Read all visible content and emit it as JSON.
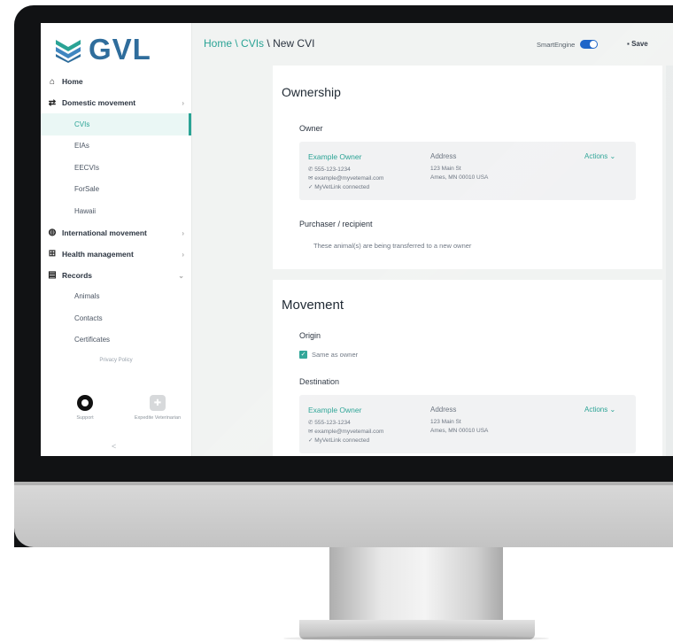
{
  "brand": {
    "name": "GVL",
    "accent": "#2aa395",
    "logo_color": "#2f6d9c",
    "toggle_color": "#1f66c8"
  },
  "header": {
    "breadcrumb": {
      "home": "Home",
      "sep1": "\\",
      "cvis": "CVIs",
      "sep2": "\\",
      "current": "New CVI"
    },
    "smart_engine_label": "SmartEngine",
    "smart_engine_on": true,
    "save_label": "Save"
  },
  "sidebar": {
    "home": "Home",
    "domestic": "Domestic movement",
    "domestic_items": [
      "CVIs",
      "EIAs",
      "EECVIs",
      "ForSale",
      "Hawaii"
    ],
    "international": "International movement",
    "health": "Health management",
    "records": "Records",
    "records_items": [
      "Animals",
      "Contacts",
      "Certificates"
    ],
    "privacy": "Privacy Policy",
    "support": "Support",
    "expedite": "Expedite Veterinarian",
    "collapse": "<"
  },
  "ownership": {
    "title": "Ownership",
    "owner_label": "Owner",
    "owner_card": {
      "name": "Example Owner",
      "phone": "555-123-1234",
      "email": "example@myvetemail.com",
      "link": "MyVetLink connected",
      "address_label": "Address",
      "address_line1": "123 Main St",
      "address_line2": "Ames, MN 00010 USA",
      "actions": "Actions"
    },
    "purchaser_label": "Purchaser / recipient",
    "purchaser_text": "These animal(s) are being transferred to a new owner"
  },
  "movement": {
    "title": "Movement",
    "origin_label": "Origin",
    "same_as_owner": "Same as owner",
    "destination_label": "Destination",
    "dest_card": {
      "name": "Example Owner",
      "phone": "555-123-1234",
      "email": "example@myvetemail.com",
      "link": "MyVetLink connected",
      "address_label": "Address",
      "address_line1": "123 Main St",
      "address_line2": "Ames, MN 00010 USA",
      "actions": "Actions"
    }
  }
}
